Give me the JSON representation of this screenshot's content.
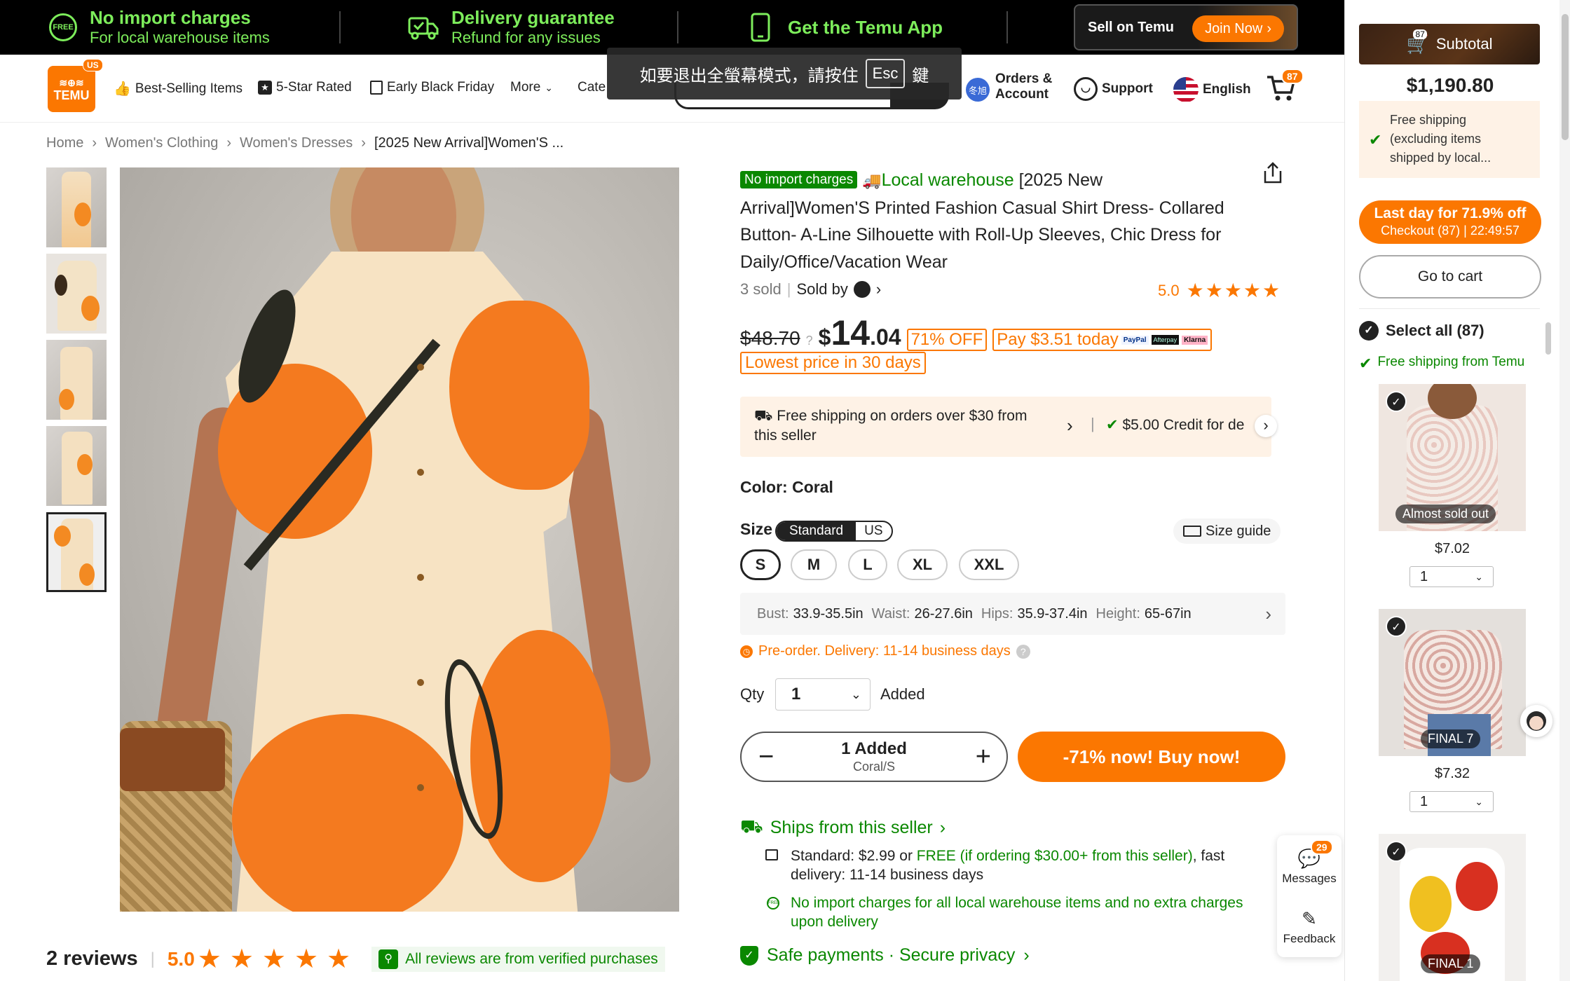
{
  "banner": {
    "item1_title": "No import charges",
    "item1_sub": "For local warehouse items",
    "item2_title": "Delivery guarantee",
    "item2_sub": "Refund for any issues",
    "item3_title": "Get the Temu App",
    "sell_label": "Sell on Temu",
    "join_label": "Join Now"
  },
  "header": {
    "logo_text": "TEMU",
    "logo_badge": "US",
    "nav": [
      "Best-Selling Items",
      "5-Star Rated",
      "Early Black Friday",
      "More",
      "Cate"
    ],
    "orders_line1": "Orders &",
    "orders_line2": "Account",
    "avatar_text": "冬旭",
    "support": "Support",
    "language": "English",
    "cart_count": "87"
  },
  "fullscreen_notice": {
    "before": "如要退出全螢幕模式，請按住",
    "key": "Esc",
    "after": "鍵"
  },
  "breadcrumb": [
    "Home",
    "Women's Clothing",
    "Women's Dresses",
    "[2025 New Arrival]Women'S ..."
  ],
  "product": {
    "badge_import": "No import charges",
    "badge_local": "Local warehouse",
    "title_line1": "[2025 New",
    "title_line2": "Arrival]Women'S Printed Fashion Casual Shirt Dress- Collared",
    "title_line3": "Button- A-Line Silhouette with Roll-Up Sleeves, Chic Dress for",
    "title_line4": "Daily/Office/Vacation Wear",
    "sold": "3 sold",
    "sold_by": "Sold by",
    "rating": "5.0",
    "old_price": "$48.70",
    "price_dollar": "$",
    "price_int": "14",
    "price_dec": ".04",
    "discount": "71% OFF",
    "pay_today": "Pay $3.51 today",
    "pay_brands": [
      "PayPal",
      "Afterpay",
      "Klarna"
    ],
    "lowest": "Lowest price in 30 days",
    "shipping_note_1": "Free shipping on orders over $30 from",
    "shipping_note_2": "this seller",
    "credit_note": "$5.00 Credit for de",
    "color_label": "Color: Coral",
    "size_label": "Size",
    "size_tabs": [
      "Standard",
      "US"
    ],
    "size_guide": "Size guide",
    "sizes": [
      "S",
      "M",
      "L",
      "XL",
      "XXL"
    ],
    "measure": {
      "bust_label": "Bust:",
      "bust": "33.9-35.5in",
      "waist_label": "Waist:",
      "waist": "26-27.6in",
      "hips_label": "Hips:",
      "hips": "35.9-37.4in",
      "height_label": "Height:",
      "height": "65-67in"
    },
    "preorder": "Pre-order. Delivery: 11-14 business days",
    "qty_label": "Qty",
    "qty_value": "1",
    "added": "Added",
    "stepper_main": "1 Added",
    "stepper_sub": "Coral/S",
    "buy_now": "-71% now! Buy now!",
    "ships_from": "Ships from this seller",
    "standard_1a": "Standard: $2.99 or ",
    "standard_1b": "FREE (if ordering $30.00+ from this seller)",
    "standard_1c": ", fast",
    "standard_2": "delivery: 11-14 business days",
    "no_import_1": "No import charges for all local warehouse items and no extra charges",
    "no_import_2": "upon delivery",
    "safe": "Safe payments · Secure privacy"
  },
  "reviews": {
    "count_label": "2 reviews",
    "rating": "5.0",
    "verified": "All reviews are from verified purchases"
  },
  "floating": {
    "messages_label": "Messages",
    "messages_count": "29",
    "feedback_label": "Feedback"
  },
  "sidecart": {
    "cart_count": "87",
    "subtotal_label": "Subtotal",
    "subtotal": "$1,190.80",
    "free_ship_1": "Free shipping",
    "free_ship_2": "(excluding items",
    "free_ship_3": "shipped by local...",
    "promo_1": "Last day for 71.9% off",
    "promo_2": "Checkout (87) | 22:49:57",
    "go_cart": "Go to cart",
    "select_all": "Select all (87)",
    "free_from": "Free shipping from Temu",
    "items": [
      {
        "tag": "Almost sold out",
        "price": "$7.02",
        "qty": "1"
      },
      {
        "tag": "FINAL 7",
        "price": "$7.32",
        "qty": "1"
      },
      {
        "tag": "FINAL 1",
        "price": "",
        "qty": ""
      }
    ]
  },
  "colors": {
    "brand": "#fb7701",
    "green": "#0a8800",
    "banner_green": "#7ded5b"
  }
}
